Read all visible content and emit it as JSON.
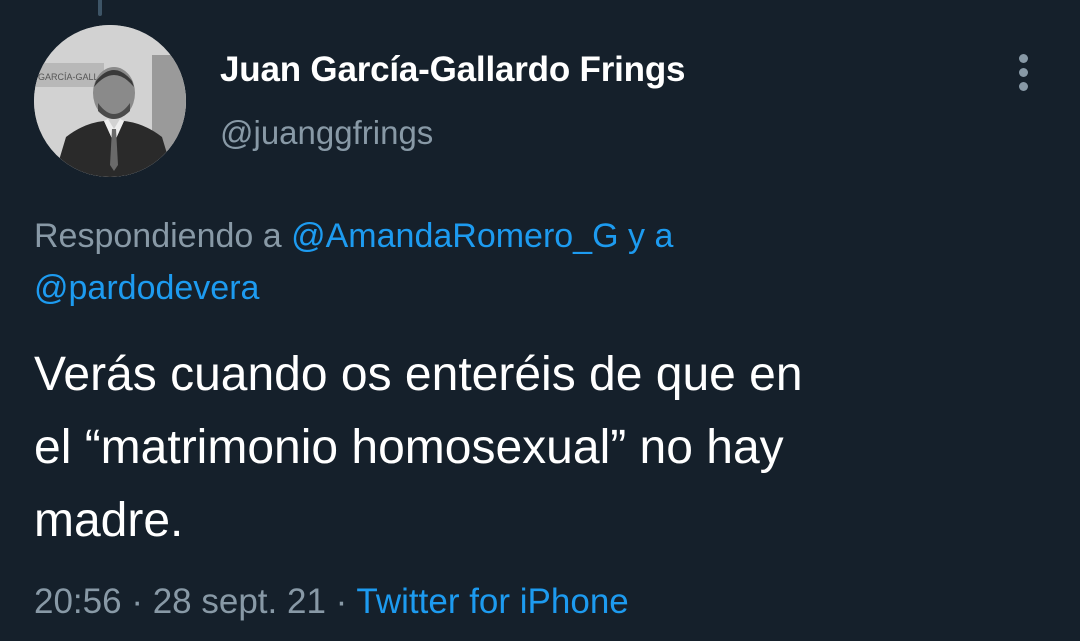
{
  "tweet": {
    "author": {
      "display_name": "Juan García-Gallardo Frings",
      "handle": "@juanggfrings",
      "avatar_sign_text": "GARCÍA-GALL"
    },
    "reply": {
      "prefix": "Respondiendo a",
      "user1": "@AmandaRomero_G",
      "connector": "y a",
      "user2": "@pardodevera"
    },
    "text_lines": [
      "Verás cuando os enteréis de que en",
      "el “matrimonio homosexual” no hay",
      "madre."
    ],
    "meta": {
      "time": "20:56",
      "separator": "·",
      "date": "28 sept. 21",
      "source": "Twitter for iPhone"
    }
  },
  "icons": {
    "more": "more-vertical-icon"
  },
  "colors": {
    "background": "#15202b",
    "primary_text": "#ffffff",
    "secondary_text": "#8899a6",
    "link": "#1d9bf0"
  }
}
